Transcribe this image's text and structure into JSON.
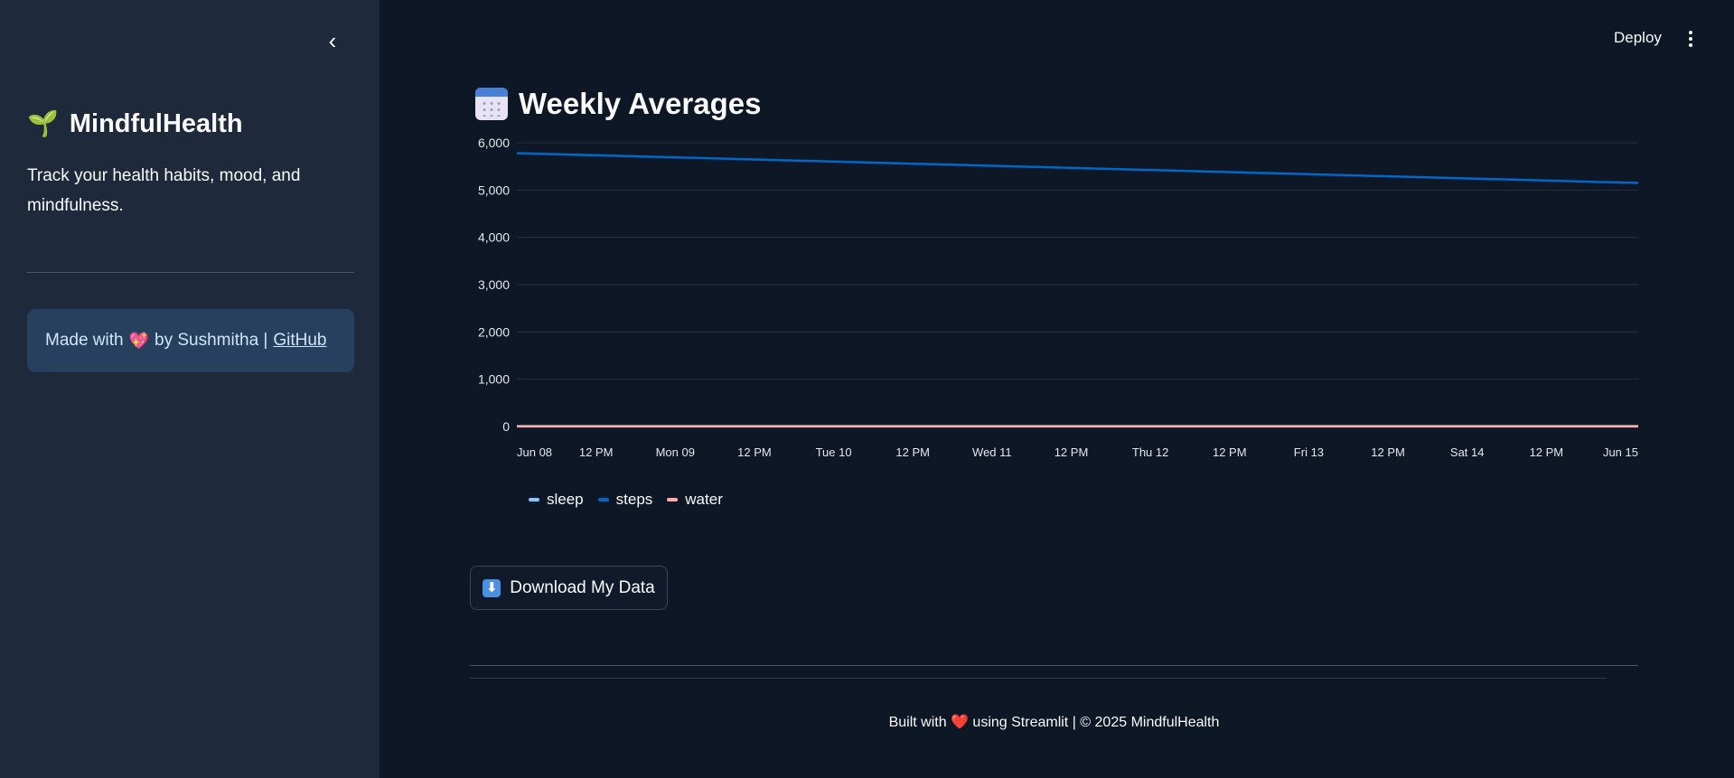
{
  "sidebar": {
    "collapse_glyph": "‹",
    "brand_icon": "🌱",
    "brand_title": "MindfulHealth",
    "tagline": "Track your health habits, mood, and mindfulness.",
    "credit_prefix": "Made with",
    "credit_heart": "💖",
    "credit_author": "by Sushmitha |",
    "credit_link": "GitHub"
  },
  "topbar": {
    "deploy_label": "Deploy",
    "menu_icon": "vertical-dots-icon"
  },
  "main": {
    "heading_icon": "calendar-icon",
    "heading": "Weekly Averages",
    "download_icon": "⬇",
    "download_label": "Download My Data",
    "footer": "Built with ❤️ using Streamlit | © 2025 MindfulHealth"
  },
  "chart_data": {
    "type": "line",
    "x_ticks": [
      "Jun 08",
      "12 PM",
      "Mon 09",
      "12 PM",
      "Tue 10",
      "12 PM",
      "Wed 11",
      "12 PM",
      "Thu 12",
      "12 PM",
      "Fri 13",
      "12 PM",
      "Sat 14",
      "12 PM",
      "Jun 15"
    ],
    "y_ticks": [
      "6,000",
      "5,000",
      "4,000",
      "3,000",
      "2,000",
      "1,000",
      "0"
    ],
    "ylim": [
      0,
      6000
    ],
    "x": [
      "2025-06-08",
      "2025-06-15"
    ],
    "series": [
      {
        "name": "sleep",
        "color": "#83c9ff",
        "values": [
          7,
          7
        ]
      },
      {
        "name": "steps",
        "color": "#0068c9",
        "values": [
          5780,
          5150
        ]
      },
      {
        "name": "water",
        "color": "#ffabab",
        "values": [
          2,
          2
        ]
      }
    ],
    "grid": true,
    "legend_position": "bottom-left"
  }
}
